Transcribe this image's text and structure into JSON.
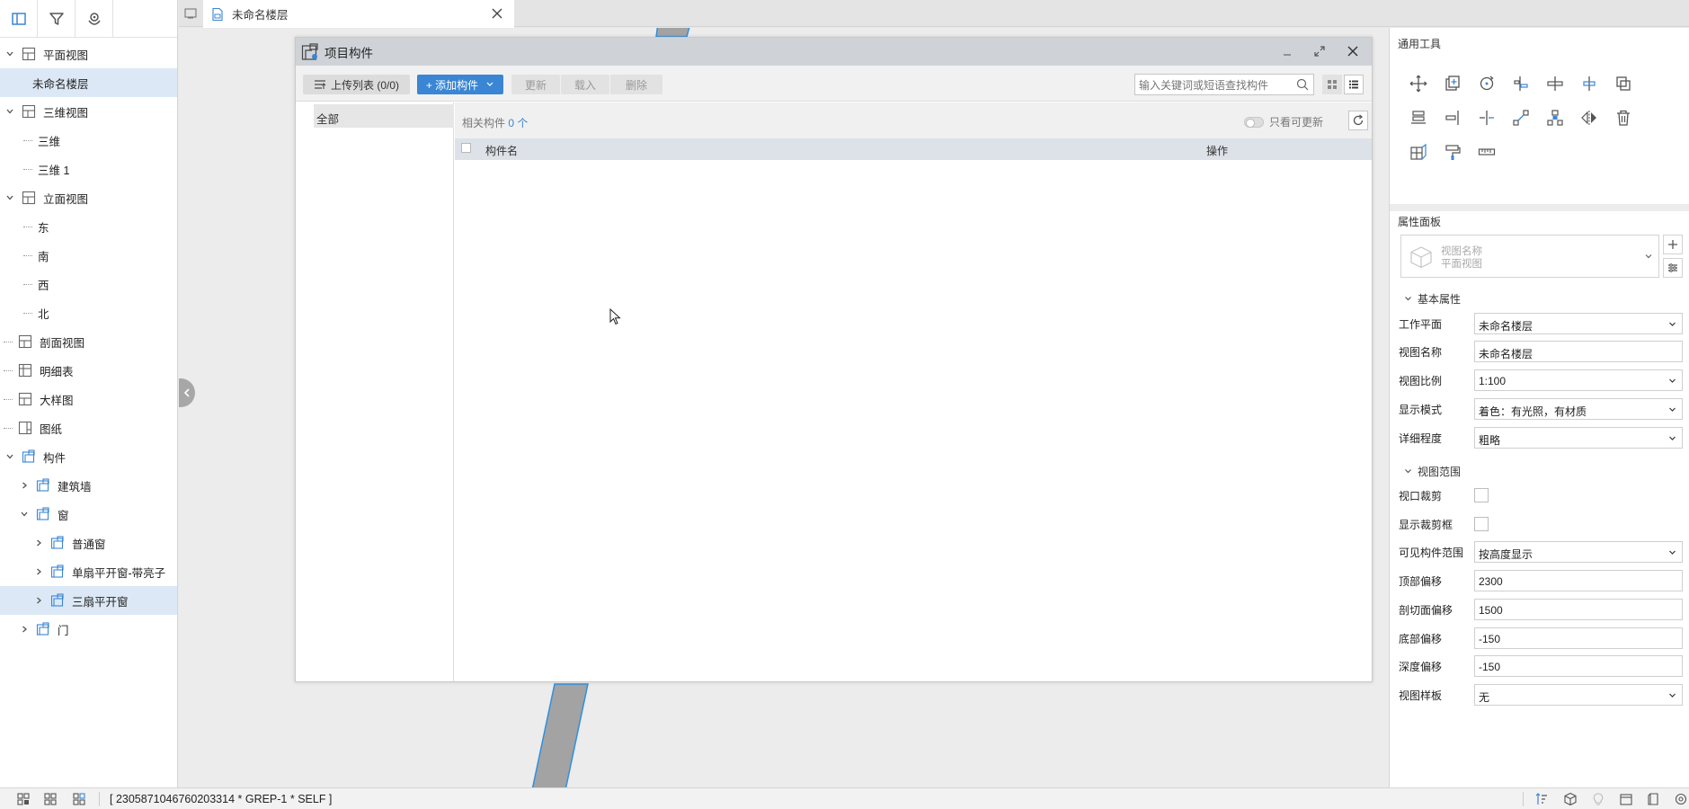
{
  "tab": {
    "title": "未命名楼层"
  },
  "tree": {
    "plan": "平面视图",
    "plan_item": "未命名楼层",
    "view3d": "三维视图",
    "view3d_a": "三维",
    "view3d_b": "三维 1",
    "elev": "立面视图",
    "elev_e": "东",
    "elev_s": "南",
    "elev_w": "西",
    "elev_n": "北",
    "section": "剖面视图",
    "schedule": "明细表",
    "detail": "大样图",
    "sheet": "图纸",
    "components": "构件",
    "wall": "建筑墙",
    "window": "窗",
    "win_normal": "普通窗",
    "win_single": "单扇平开窗-带亮子",
    "win_triple": "三扇平开窗",
    "door": "门"
  },
  "dialog": {
    "title": "项目构件",
    "upload_label": "上传列表 (0/0)",
    "add_label": "+ 添加构件",
    "update_label": "更新",
    "load_label": "载入",
    "delete_label": "删除",
    "search_placeholder": "输入关键词或短语查找构件",
    "category_all": "全部",
    "related_label": "相关构件",
    "related_count": "0 个",
    "only_updatable": "只看可更新",
    "col_name": "构件名",
    "col_op": "操作"
  },
  "right": {
    "tools_title": "通用工具",
    "props_title": "属性面板",
    "selector_line1": "视图名称",
    "selector_line2": "平面视图",
    "basic_section": "基本属性",
    "range_section": "视图范围",
    "props": [
      {
        "label": "工作平面",
        "value": "未命名楼层"
      },
      {
        "label": "视图名称",
        "value": "未命名楼层"
      },
      {
        "label": "视图比例",
        "value": "1:100"
      },
      {
        "label": "显示模式",
        "value": "着色：有光照，有材质"
      },
      {
        "label": "详细程度",
        "value": "粗略"
      }
    ],
    "range_props": [
      {
        "label": "视口裁剪"
      },
      {
        "label": "显示裁剪框"
      },
      {
        "label": "可见构件范围",
        "value": "按高度显示"
      },
      {
        "label": "顶部偏移",
        "value": "2300"
      },
      {
        "label": "剖切面偏移",
        "value": "1500"
      },
      {
        "label": "底部偏移",
        "value": "-150"
      },
      {
        "label": "深度偏移",
        "value": "-150"
      },
      {
        "label": "视图样板",
        "value": "无"
      }
    ]
  },
  "status": {
    "text": "[ 2305871046760203314 * GREP-1 * SELF ]"
  },
  "colors": {
    "accent": "#3a86d4",
    "selected": "#dce8f5",
    "wall_outline": "#2e90e0"
  }
}
